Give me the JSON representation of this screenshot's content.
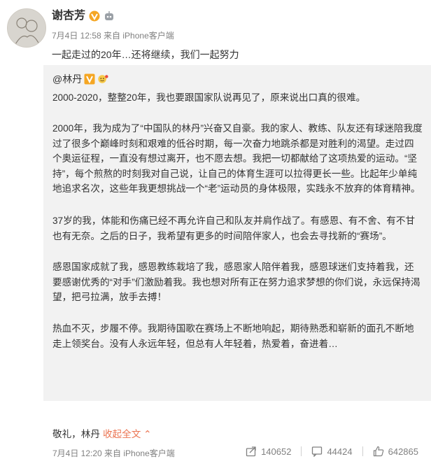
{
  "post": {
    "author_name": "谢杏芳",
    "meta": "7月4日 12:58 来自 iPhone客户端",
    "text": "一起走过的20年…还将继续，我们一起努力"
  },
  "repost": {
    "author": "@林丹",
    "paragraphs": [
      "2000-2020，整整20年，我也要跟国家队说再见了，原来说出口真的很难。",
      "2000年，我为成为了“中国队的林丹”兴奋又自豪。我的家人、教练、队友还有球迷陪我度过了很多个巅峰时刻和艰难的低谷时期，每一次奋力地跳杀都是对胜利的渴望。走过四个奥运征程，一直没有想过离开，也不愿去想。我把一切都献给了这项热爱的运动。“坚持”，每个煎熬的时刻我对自己说，让自己的体育生涯可以拉得更长一些。比起年少单纯地追求名次，这些年我更想挑战一个“老”运动员的身体极限，实践永不放弃的体育精神。",
      "37岁的我，体能和伤痛已经不再允许自己和队友并肩作战了。有感恩、有不舍、有不甘也有无奈。之后的日子，我希望有更多的时间陪伴家人，也会去寻找新的“赛场”。",
      "感恩国家成就了我，感恩教练栽培了我，感恩家人陪伴着我，感恩球迷们支持着我，还要感谢优秀的“对手”们激励着我。我也想对所有正在努力追求梦想的你们说，永远保持渴望，把弓拉满，放手去搏！",
      "热血不灭，步履不停。我期待国歌在赛场上不断地响起，期待熟悉和崭新的面孔不断地走上领奖台。没有人永远年轻，但总有人年轻着，热爱着，奋进着…"
    ],
    "signature": "敬礼，林丹",
    "collapse_label": "收起全文",
    "meta": "7月4日 12:20 来自 iPhone客户端",
    "reposts": "140652",
    "comments": "44424",
    "likes": "642865"
  },
  "icons": {
    "vip": "verified-v-icon",
    "robot": "robot-icon",
    "repost": "share-icon",
    "comment": "comment-icon",
    "like": "thumbs-up-icon"
  },
  "colors": {
    "link": "#eb7350",
    "repost_bg": "#f2f2f2",
    "vip_badge": "#f5a623"
  }
}
